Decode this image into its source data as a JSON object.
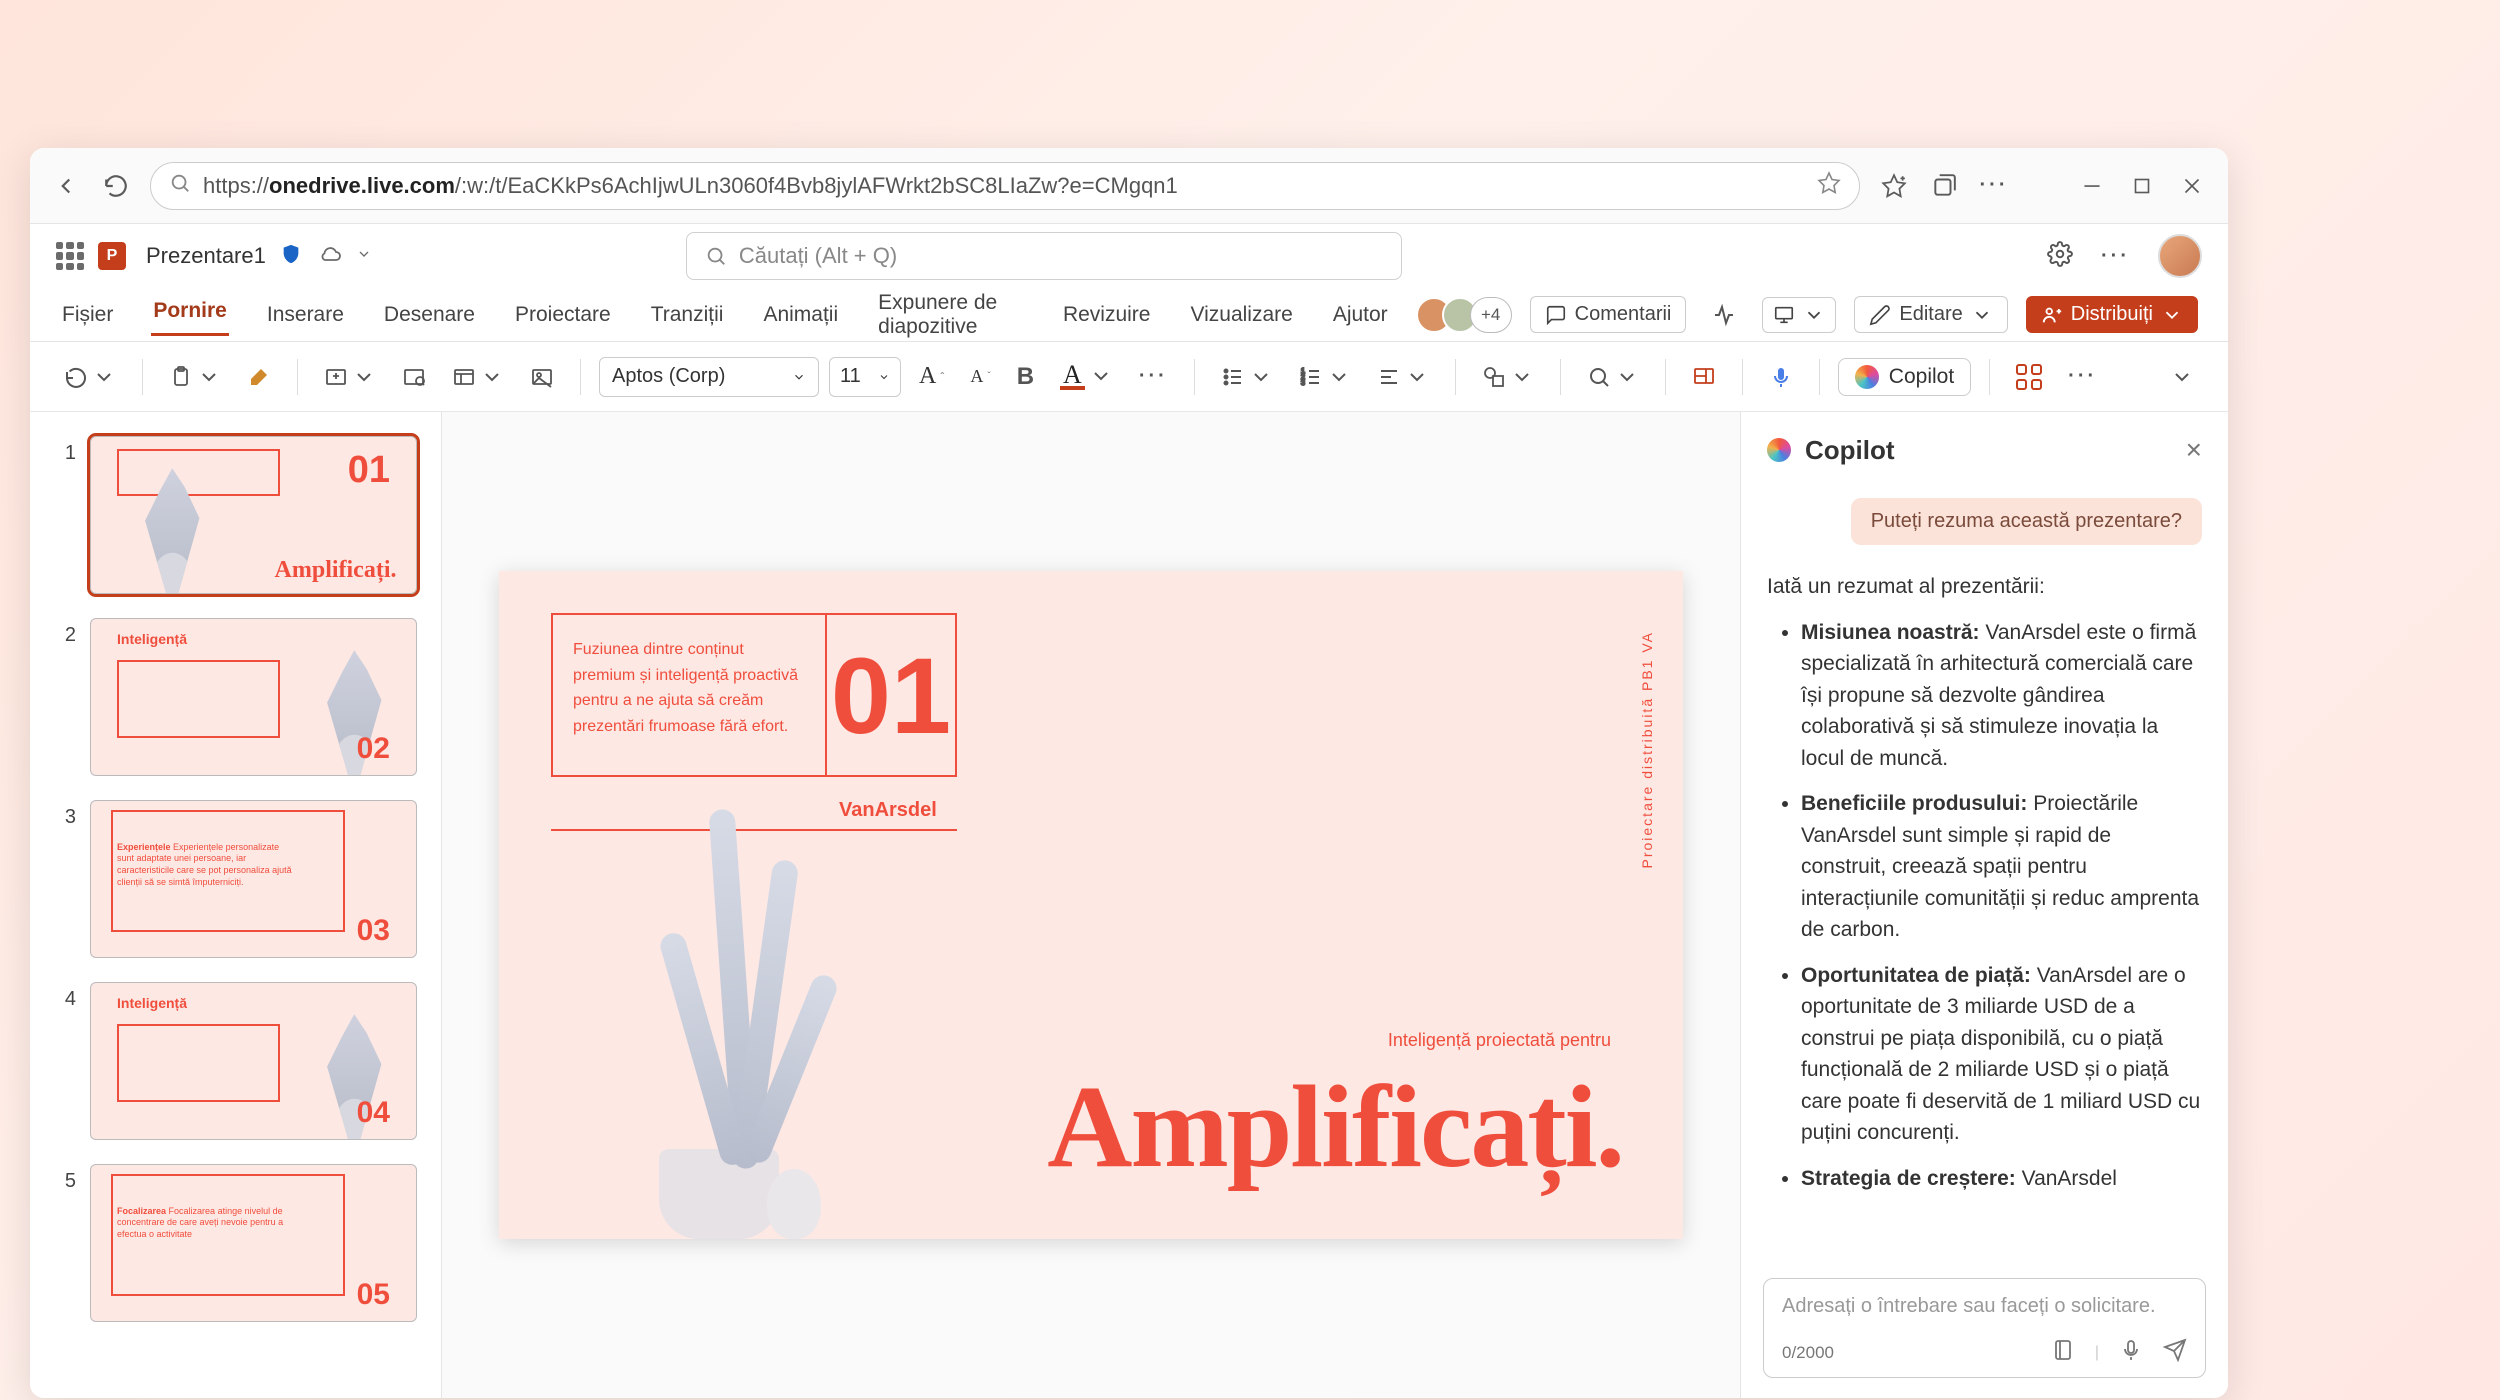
{
  "browser": {
    "url_domain": "onedrive.live.com",
    "url_path": "/:w:/t/EaCKkPs6AchIjwULn3060f4Bvb8jylAFWrkt2bSC8LIaZw?e=CMgqn1"
  },
  "title": {
    "doc": "Prezentare1"
  },
  "search": {
    "placeholder": "Căutați (Alt + Q)"
  },
  "tabs": {
    "file": "Fișier",
    "home": "Pornire",
    "insert": "Inserare",
    "draw": "Desenare",
    "design": "Proiectare",
    "transitions": "Tranziții",
    "animations": "Animații",
    "slideshow": "Expunere de diapozitive",
    "review": "Revizuire",
    "view": "Vizualizare",
    "help": "Ajutor"
  },
  "ribbon_right": {
    "plusN": "+4",
    "comments": "Comentarii",
    "editing": "Editare",
    "share": "Distribuiți"
  },
  "toolbar": {
    "font": "Aptos (Corp)",
    "size": "11",
    "copilot": "Copilot"
  },
  "thumbs": [
    {
      "n": "1",
      "num": "01",
      "title": "Amplificați."
    },
    {
      "n": "2",
      "num": "02",
      "title": "Inteligență"
    },
    {
      "n": "3",
      "num": "03",
      "title": "Experiențele",
      "para": "Experiențele personalizate sunt adaptate unei persoane, iar caracteristicile care se pot personaliza ajută clienții să se simtă împuterniciți."
    },
    {
      "n": "4",
      "num": "04",
      "title": "Inteligență"
    },
    {
      "n": "5",
      "num": "05",
      "title": "Focalizarea",
      "para": "Focalizarea atinge nivelul de concentrare de care aveți nevoie pentru a efectua o activitate"
    }
  ],
  "slide": {
    "num": "01",
    "frame_text": "Fuziunea dintre conținut premium și inteligență proactivă pentru a ne ajuta să creăm prezentări frumoase fără efort.",
    "brand": "VanArsdel",
    "subtitle": "Inteligență proiectată pentru",
    "title": "Amplificați.",
    "side_vertical": "Proiectare distribuită PB1 VA"
  },
  "copilot": {
    "title": "Copilot",
    "suggest": "Puteți rezuma această prezentare?",
    "intro": "Iată un rezumat al prezentării:",
    "bullets": [
      {
        "b": "Misiunea noastră:",
        "t": " VanArsdel este o firmă specializată în arhitectură comercială care își propune să dezvolte gândirea colaborativă și să stimuleze inovația la locul de muncă."
      },
      {
        "b": "Beneficiile produsului:",
        "t": " Proiectările VanArsdel sunt simple și rapid de construit, creează spații pentru interacțiunile comunității și reduc amprenta de carbon."
      },
      {
        "b": "Oportunitatea de piață:",
        "t": " VanArsdel are o oportunitate de 3 miliarde USD de a construi pe piața disponibilă, cu o piață funcțională de 2 miliarde USD și o piață care poate fi deservită de 1 miliard USD cu puțini concurenți."
      },
      {
        "b": "Strategia de creștere:",
        "t": " VanArsdel"
      }
    ],
    "input_placeholder": "Adresați o întrebare sau faceți o solicitare.",
    "counter": "0/2000"
  }
}
